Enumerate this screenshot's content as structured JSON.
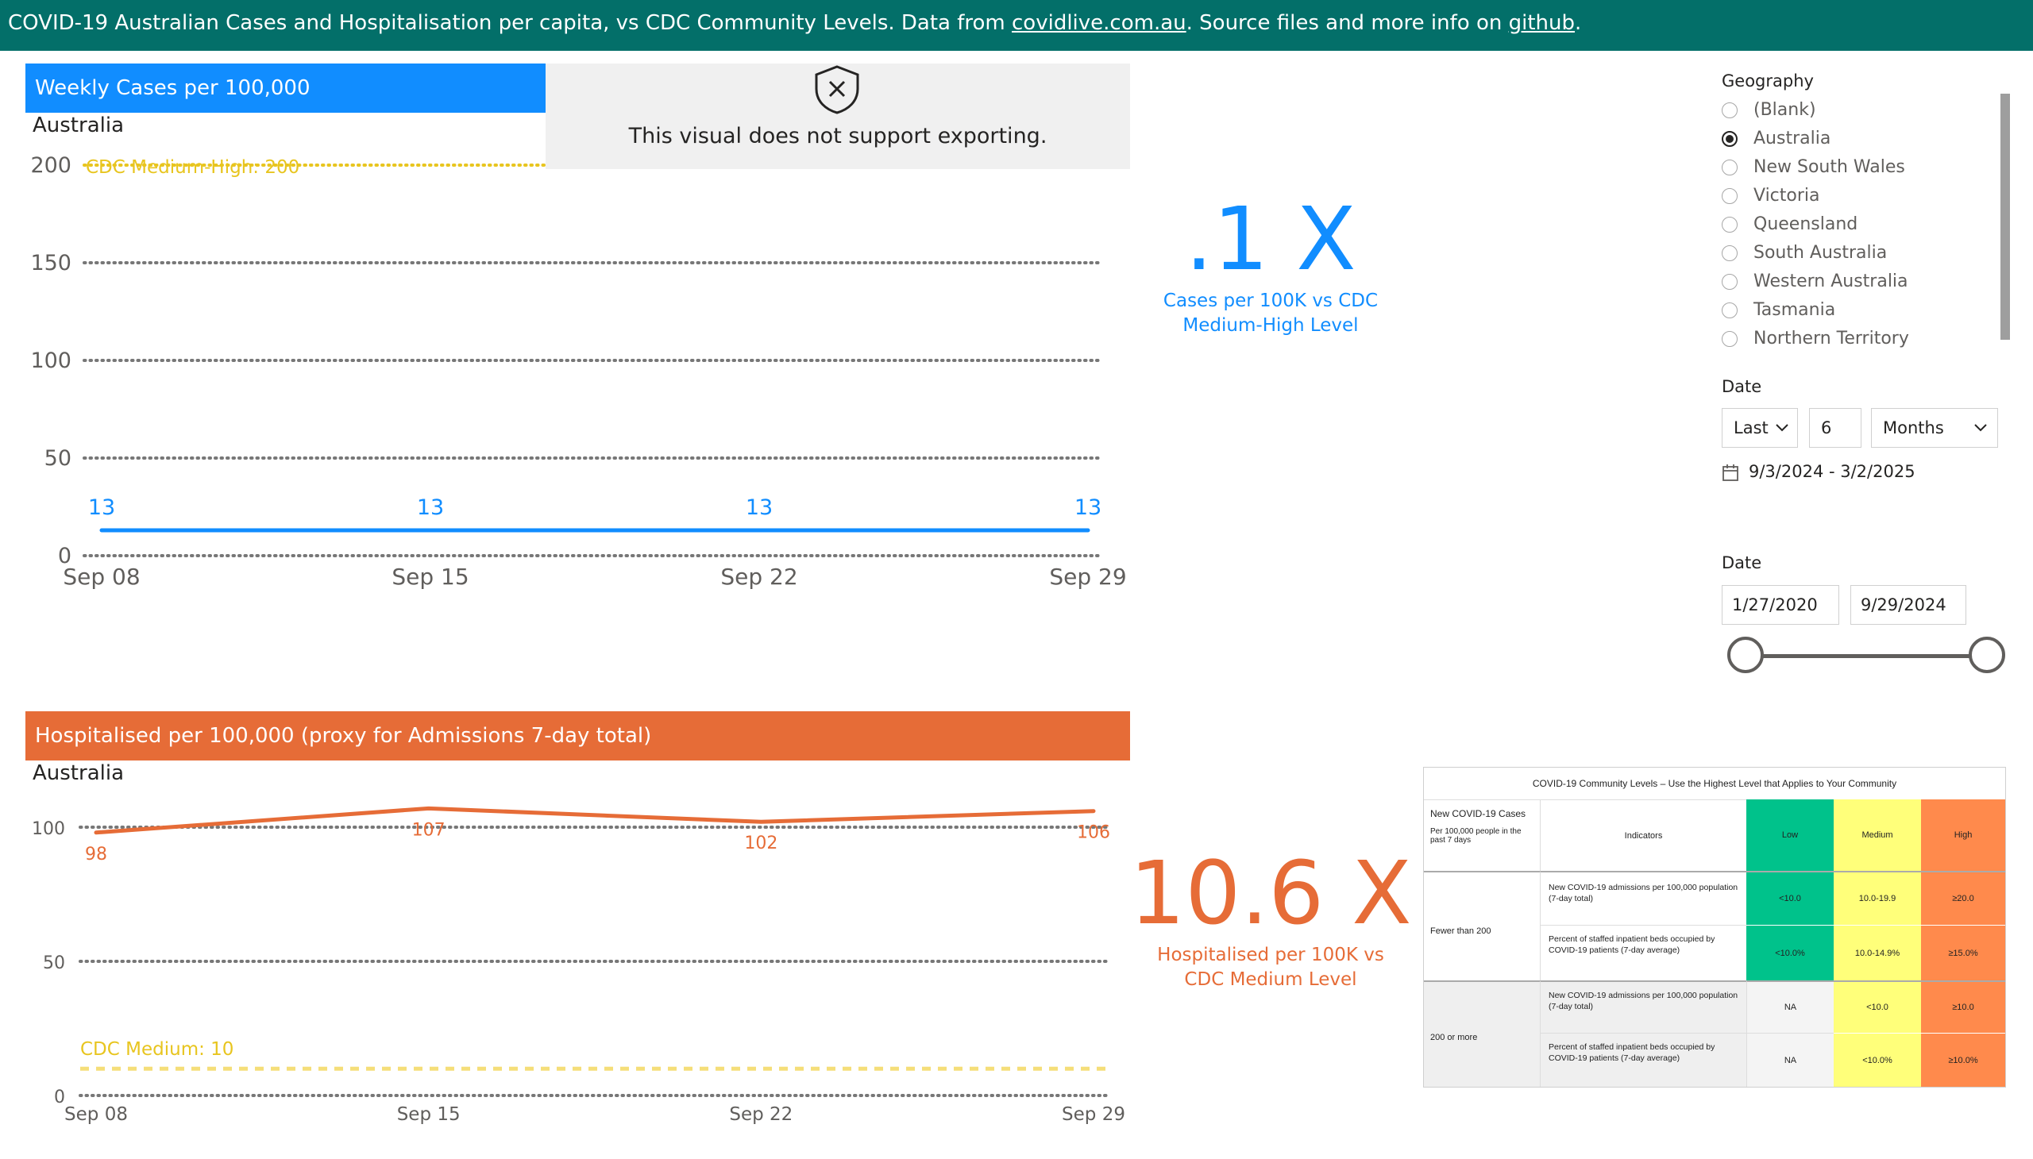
{
  "banner": {
    "prefix": "COVID-19 Australian Cases and Hospitalisation per capita, vs CDC Community Levels. Data from ",
    "link1": "covidlive.com.au",
    "mid": ". Source files and more info on ",
    "link2": "github",
    "suffix": "."
  },
  "colors": {
    "banner": "#036F69",
    "cases": "#118DFF",
    "hosp": "#E66C37",
    "threshold": "#E8C51F"
  },
  "cases_card": {
    "title": "Weekly Cases per 100,000",
    "location": "Australia",
    "threshold_label": "CDC Medium-High: 200",
    "export_notice": "This visual does not support exporting."
  },
  "hosp_card": {
    "title": "Hospitalised per 100,000 (proxy for Admissions 7-day total)",
    "location": "Australia",
    "threshold_label": "CDC Medium: 10"
  },
  "chart_data": [
    {
      "type": "line",
      "categories": [
        "Sep 08",
        "Sep 15",
        "Sep 22",
        "Sep 29"
      ],
      "series": [
        {
          "values": [
            13,
            13,
            13,
            13
          ]
        }
      ],
      "reference_line": {
        "label": "CDC Medium-High: 200",
        "value": 200
      },
      "ylim": [
        0,
        200
      ],
      "yticks": [
        0,
        50,
        100,
        150,
        200
      ],
      "grid": true
    },
    {
      "type": "line",
      "categories": [
        "Sep 08",
        "Sep 15",
        "Sep 22",
        "Sep 29"
      ],
      "series": [
        {
          "values": [
            98,
            107,
            102,
            106
          ]
        }
      ],
      "reference_line": {
        "label": "CDC Medium: 10",
        "value": 10
      },
      "ylim": [
        0,
        100
      ],
      "yticks": [
        0,
        50,
        100
      ],
      "grid": true
    }
  ],
  "kpi_cases": {
    "value": ".1 X",
    "label_line1": "Cases per 100K vs CDC",
    "label_line2": "Medium-High Level"
  },
  "kpi_hosp": {
    "value": "10.6 X",
    "label_line1": "Hospitalised per 100K vs",
    "label_line2": "CDC Medium Level"
  },
  "geography": {
    "title": "Geography",
    "options": [
      "(Blank)",
      "Australia",
      "New South Wales",
      "Victoria",
      "Queensland",
      "South Australia",
      "Western Australia",
      "Tasmania",
      "Northern Territory"
    ],
    "selected": "Australia"
  },
  "date_relative": {
    "title": "Date",
    "mode": "Last",
    "count": "6",
    "unit": "Months",
    "range_text": "9/3/2024 - 3/2/2025"
  },
  "date_range": {
    "title": "Date",
    "start": "1/27/2020",
    "end": "9/29/2024"
  },
  "cdc_table": {
    "title": "COVID-19 Community Levels – Use the Highest Level that Applies to Your Community",
    "col_cases": "New COVID-19 Cases",
    "col_cases_sub": "Per 100,000 people in the past 7 days",
    "col_indicators": "Indicators",
    "col_low": "Low",
    "col_medium": "Medium",
    "col_high": "High",
    "group1": "Fewer than 200",
    "group2": "200 or more",
    "ind_admissions": "New COVID-19 admissions per 100,000 population (7-day total)",
    "ind_beds": "Percent of staffed inpatient beds occupied by COVID-19 patients (7-day average)",
    "r1": [
      "<10.0",
      "10.0-19.9",
      "≥20.0"
    ],
    "r2": [
      "<10.0%",
      "10.0-14.9%",
      "≥15.0%"
    ],
    "r3": [
      "NA",
      "<10.0",
      "≥10.0"
    ],
    "r4": [
      "NA",
      "<10.0%",
      "≥10.0%"
    ]
  }
}
